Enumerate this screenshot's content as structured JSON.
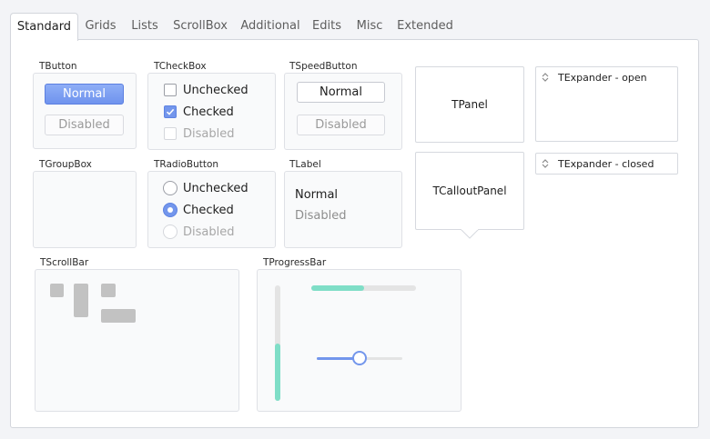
{
  "tabs": [
    {
      "label": "Standard",
      "active": true
    },
    {
      "label": "Grids"
    },
    {
      "label": "Lists"
    },
    {
      "label": "ScrollBox"
    },
    {
      "label": "Additional"
    },
    {
      "label": "Edits"
    },
    {
      "label": "Misc"
    },
    {
      "label": "Extended"
    }
  ],
  "groups": {
    "tbutton": {
      "title": "TButton",
      "normal": "Normal",
      "disabled": "Disabled"
    },
    "tcheckbox": {
      "title": "TCheckBox",
      "unchecked": "Unchecked",
      "checked": "Checked",
      "disabled": "Disabled"
    },
    "tspeedbutton": {
      "title": "TSpeedButton",
      "normal": "Normal",
      "disabled": "Disabled"
    },
    "tgroupbox": {
      "title": "TGroupBox"
    },
    "tradiobutton": {
      "title": "TRadioButton",
      "unchecked": "Unchecked",
      "checked": "Checked",
      "disabled": "Disabled"
    },
    "tlabel": {
      "title": "TLabel",
      "normal": "Normal",
      "disabled": "Disabled"
    },
    "tscrollbar": {
      "title": "TScrollBar"
    },
    "tprogressbar": {
      "title": "TProgressBar"
    }
  },
  "panels": {
    "tpanel": "TPanel",
    "tcalloutpanel": "TCalloutPanel"
  },
  "expanders": {
    "open": "TExpander - open",
    "closed": "TExpander - closed"
  },
  "progress": {
    "horizontal": 0.5,
    "vertical": 0.5,
    "slider": 0.5
  },
  "colors": {
    "accent": "#7396ec",
    "progress_fill": "#7fdec7",
    "track": "#e4e4e4"
  },
  "icons": {
    "checkmark": "checkmark-icon",
    "expander": "chevron-updown-icon",
    "radio_dot": "radio-dot-icon"
  }
}
